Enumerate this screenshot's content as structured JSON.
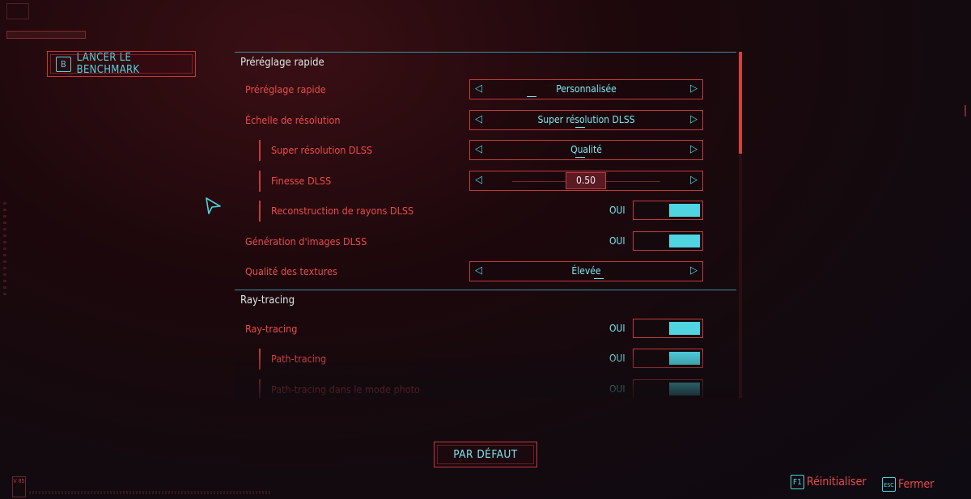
{
  "benchmark": {
    "key": "B",
    "label": "LANCER LE BENCHMARK"
  },
  "version": "V 85",
  "sections": [
    {
      "title": "Préréglage rapide"
    },
    {
      "title": "Ray-tracing"
    }
  ],
  "rows": [
    {
      "label": "Préréglage rapide",
      "value": "Personnalisée"
    },
    {
      "label": "Échelle de résolution",
      "value": "Super résolution DLSS"
    },
    {
      "label": "Super résolution DLSS",
      "value": "Qualité"
    },
    {
      "label": "Finesse DLSS",
      "value": "0.50",
      "slider_fraction": 0.5
    },
    {
      "label": "Reconstruction de rayons DLSS",
      "value": "OUI"
    },
    {
      "label": "Génération d'images DLSS",
      "value": "OUI"
    },
    {
      "label": "Qualité des textures",
      "value": "Élevée"
    },
    {
      "label": "Ray-tracing",
      "value": "OUI"
    },
    {
      "label": "Path-tracing",
      "value": "OUI"
    },
    {
      "label": "Path-tracing dans le mode photo",
      "value": "OUI"
    }
  ],
  "arrows": {
    "left": "◁",
    "right": "▷"
  },
  "default_button": "PAR DÉFAUT",
  "hints": [
    {
      "key": "F1",
      "label": "Réinitialiser"
    },
    {
      "key": "ESC",
      "label": "Fermer"
    }
  ],
  "colors": {
    "accent_cyan": "#4fd4e0",
    "accent_red": "#ec4a4a",
    "border_red": "#c23a40",
    "background": "#130b10"
  }
}
